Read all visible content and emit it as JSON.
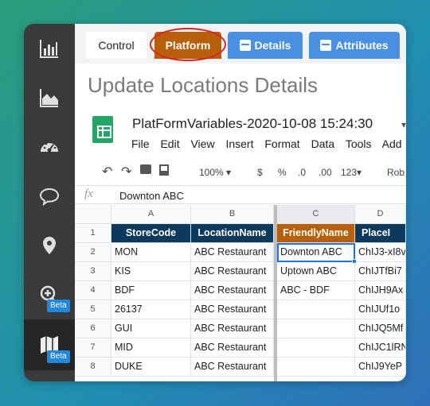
{
  "sidebar": {
    "items": [
      {
        "icon": "bar-chart-icon"
      },
      {
        "icon": "area-chart-icon"
      },
      {
        "icon": "dashboard-gauge-icon"
      },
      {
        "icon": "speech-bubble-icon"
      },
      {
        "icon": "location-pin-icon"
      },
      {
        "icon": "add-location-icon",
        "badge": "Beta"
      },
      {
        "icon": "map-icon",
        "badge": "Beta"
      }
    ]
  },
  "tabs": {
    "control": "Control",
    "platform": "Platform",
    "details": "Details",
    "attributes": "Attributes"
  },
  "colors": {
    "platform": "#b85f0a",
    "tab_blue": "#4a90e2",
    "header_navy": "#0d3a5c",
    "sheets_green": "#23a566"
  },
  "page_title": "Update Locations Details",
  "doc": {
    "title": "PlatFormVariables-2020-10-08 15:24:30",
    "menu": [
      "File",
      "Edit",
      "View",
      "Insert",
      "Format",
      "Data",
      "Tools",
      "Add"
    ]
  },
  "toolbar": {
    "zoom": "100%",
    "currency": "$",
    "percent": "%",
    "decrease_decimal": ".0",
    "increase_decimal": ".00",
    "more_formats": "123",
    "font": "Rob"
  },
  "formula_bar": {
    "fx": "fx",
    "value": "Downton ABC"
  },
  "grid": {
    "columns": [
      "A",
      "B",
      "C",
      "D"
    ],
    "header_row": [
      "StoreCode",
      "LocationName",
      "FriendlyName",
      "PlaceI"
    ],
    "rows": [
      {
        "num": "1"
      },
      {
        "num": "2",
        "cells": [
          "MON",
          "ABC Restaurant",
          "Downton ABC",
          "ChIJ3-xI8v"
        ]
      },
      {
        "num": "3",
        "cells": [
          "KIS",
          "ABC Restaurant",
          "Uptown ABC",
          "ChIJTfBi7"
        ]
      },
      {
        "num": "4",
        "cells": [
          "BDF",
          "ABC Restaurant",
          "ABC - BDF",
          "ChIJH9Ax"
        ]
      },
      {
        "num": "5",
        "cells": [
          "26137",
          "ABC Restaurant",
          "",
          "ChIJUf1o"
        ]
      },
      {
        "num": "6",
        "cells": [
          "GUI",
          "ABC Restaurant",
          "",
          "ChIJQ5Mf"
        ]
      },
      {
        "num": "7",
        "cells": [
          "MID",
          "ABC Restaurant",
          "",
          "ChIJC1lRN"
        ]
      },
      {
        "num": "8",
        "cells": [
          "DUKE",
          "ABC Restaurant",
          "",
          "ChIJ9YeP"
        ]
      }
    ]
  }
}
